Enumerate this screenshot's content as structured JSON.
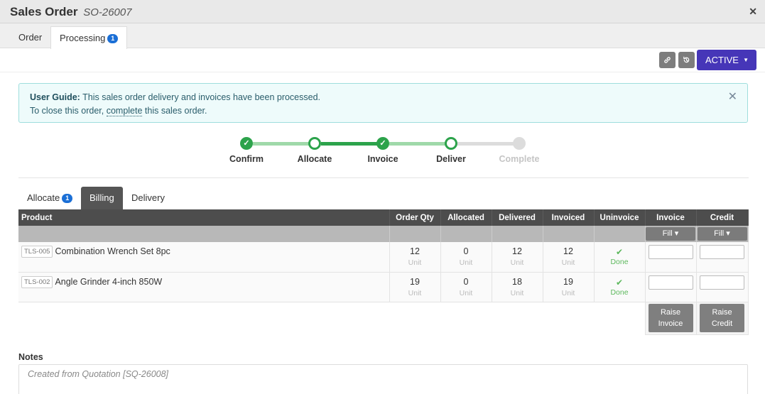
{
  "window": {
    "title": "Sales Order",
    "order_id": "SO-26007",
    "close_icon": "close-icon"
  },
  "tabs": [
    {
      "label": "Order"
    },
    {
      "label": "Processing",
      "badge": "1"
    }
  ],
  "actions": {
    "link_icon": "link-icon",
    "history_icon": "history-icon",
    "status_label": "ACTIVE"
  },
  "guide": {
    "title": "User Guide:",
    "line1": "This sales order delivery and invoices have been processed.",
    "line2_prefix": "To close this order,",
    "line2_link": "complete",
    "line2_suffix": "this sales order."
  },
  "steps": [
    {
      "label": "Confirm",
      "state": "done"
    },
    {
      "label": "Allocate",
      "state": "open"
    },
    {
      "label": "Invoice",
      "state": "done"
    },
    {
      "label": "Deliver",
      "state": "open"
    },
    {
      "label": "Complete",
      "state": "todo"
    }
  ],
  "subtabs": [
    {
      "label": "Allocate",
      "badge": "1"
    },
    {
      "label": "Billing"
    },
    {
      "label": "Delivery"
    }
  ],
  "table": {
    "headers": [
      "Product",
      "Order Qty",
      "Allocated",
      "Delivered",
      "Invoiced",
      "Uninvoice",
      "Invoice",
      "Credit"
    ],
    "fill_label": "Fill",
    "unit_label": "Unit",
    "done_label": "Done",
    "rows": [
      {
        "code": "TLS-005",
        "name": "Combination Wrench Set 8pc",
        "order_qty": "12",
        "allocated": "0",
        "delivered": "12",
        "invoiced": "12",
        "invoice_value": "",
        "credit_value": ""
      },
      {
        "code": "TLS-002",
        "name": "Angle Grinder 4-inch 850W",
        "order_qty": "19",
        "allocated": "0",
        "delivered": "18",
        "invoiced": "19",
        "invoice_value": "",
        "credit_value": ""
      }
    ],
    "raise_invoice": [
      "Raise",
      "Invoice"
    ],
    "raise_credit": [
      "Raise",
      "Credit"
    ]
  },
  "notes": {
    "label": "Notes",
    "value": "Created from Quotation [SQ-26008]"
  },
  "colors": {
    "accent": "#4636b8",
    "step_done": "#2ca34b",
    "badge": "#1b6fd6"
  }
}
